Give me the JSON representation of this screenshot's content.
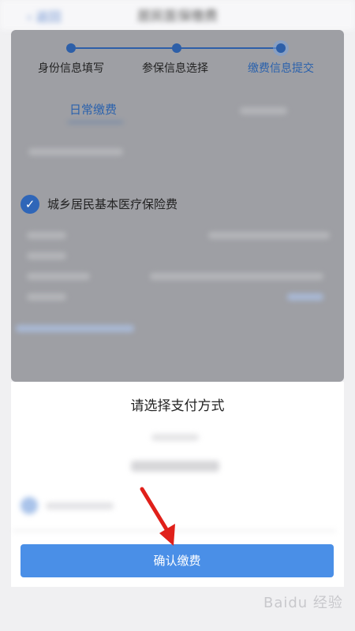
{
  "header": {
    "title": "居民医保缴费",
    "back_label": "‹ 返回"
  },
  "steps": [
    {
      "label": "身份信息填写",
      "state": "done"
    },
    {
      "label": "参保信息选择",
      "state": "done"
    },
    {
      "label": "缴费信息提交",
      "state": "active"
    }
  ],
  "tabs": [
    {
      "label": "日常缴费",
      "selected": true
    }
  ],
  "insurance_item": {
    "label": "城乡居民基本医疗保险费",
    "checked": true
  },
  "payment_dialog": {
    "title": "请选择支付方式"
  },
  "confirm_button": {
    "label": "确认缴费"
  },
  "watermark": {
    "text": "Baidu 经验"
  },
  "colors": {
    "accent": "#4a8fe7",
    "primary": "#2b62ad",
    "arrow": "#e0201a"
  }
}
